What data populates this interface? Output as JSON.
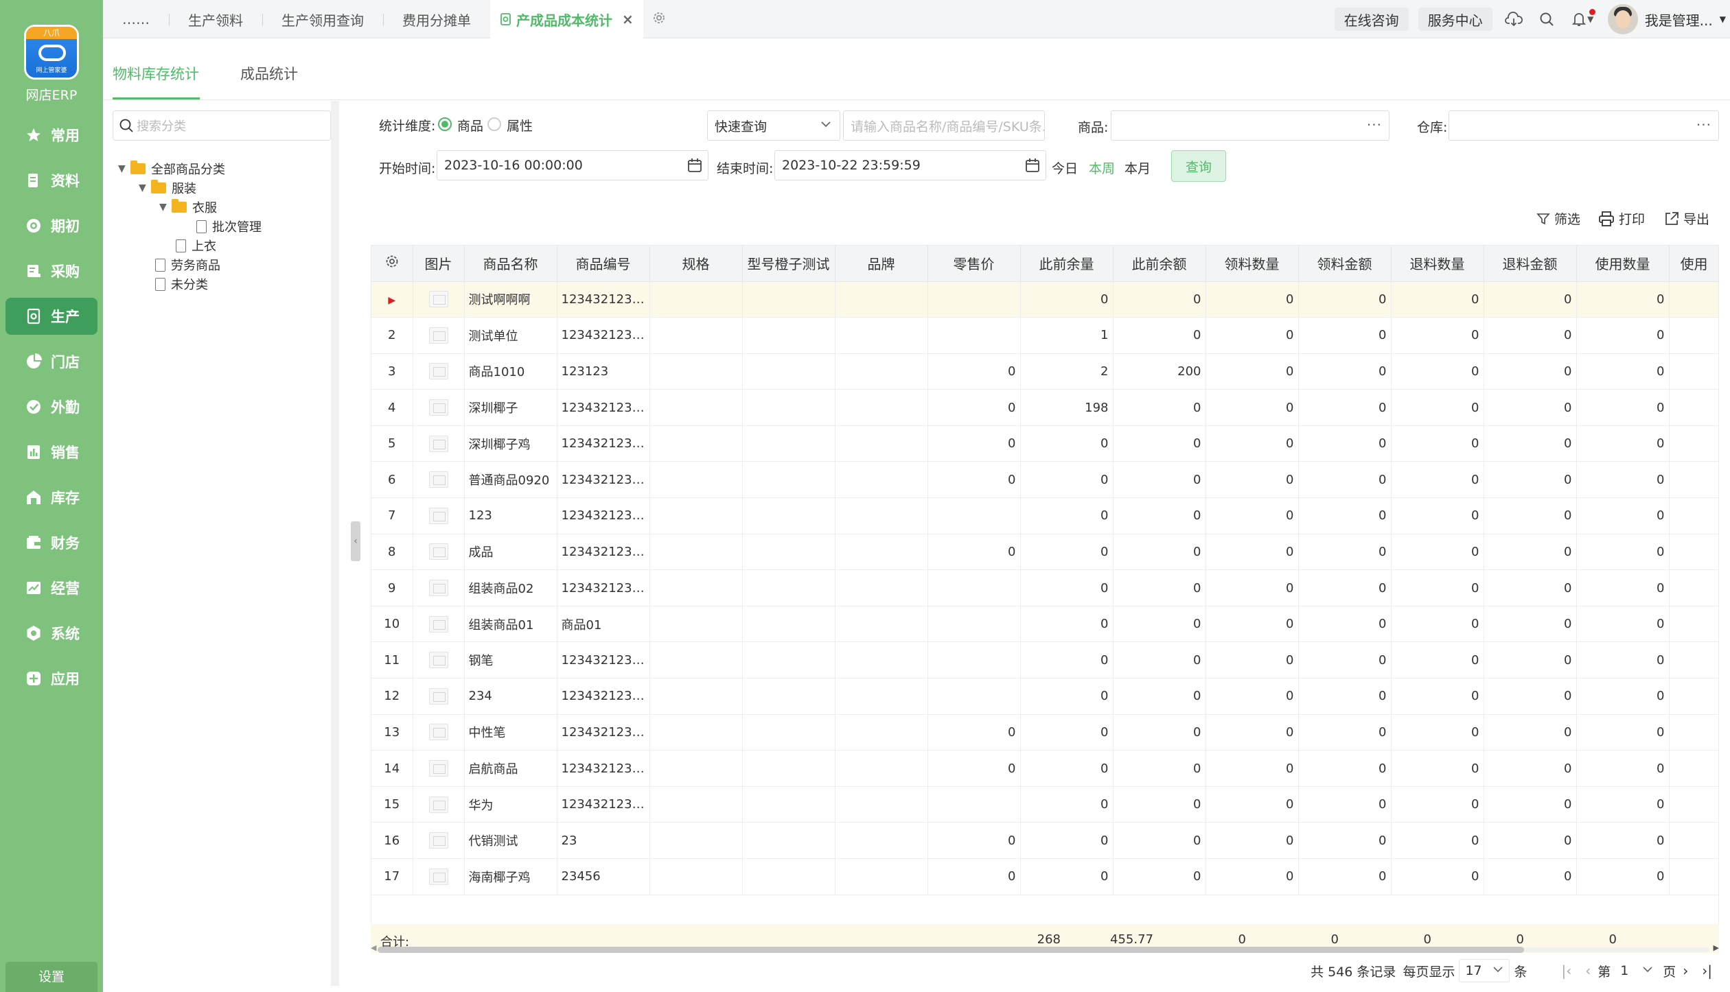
{
  "app": {
    "logo_badge": "八爪",
    "logo_text": "网上管家婆",
    "name": "网店ERP",
    "settings_label": "设置"
  },
  "nav": [
    {
      "label": "常用",
      "icon": "star-icon",
      "active": false
    },
    {
      "label": "资料",
      "icon": "document-icon",
      "active": false
    },
    {
      "label": "期初",
      "icon": "target-icon",
      "active": false
    },
    {
      "label": "采购",
      "icon": "purchase-icon",
      "active": false
    },
    {
      "label": "生产",
      "icon": "production-icon",
      "active": true
    },
    {
      "label": "门店",
      "icon": "pie-icon",
      "active": false
    },
    {
      "label": "外勤",
      "icon": "field-icon",
      "active": false
    },
    {
      "label": "销售",
      "icon": "bar-chart-icon",
      "active": false
    },
    {
      "label": "库存",
      "icon": "warehouse-icon",
      "active": false
    },
    {
      "label": "财务",
      "icon": "wallet-icon",
      "active": false
    },
    {
      "label": "经营",
      "icon": "trend-icon",
      "active": false
    },
    {
      "label": "系统",
      "icon": "gear-icon",
      "active": false
    },
    {
      "label": "应用",
      "icon": "plus-square-icon",
      "active": false
    }
  ],
  "tabs": {
    "ellipsis": "……",
    "items": [
      "生产领料",
      "生产领用查询",
      "费用分摊单"
    ],
    "active": "产成品成本统计",
    "close": "×"
  },
  "topright": {
    "consult": "在线咨询",
    "service": "服务中心",
    "user": "我是管理..."
  },
  "subtabs": [
    "物料库存统计",
    "成品统计"
  ],
  "tree": {
    "search_placeholder": "搜索分类",
    "nodes": [
      {
        "label": "全部商品分类",
        "type": "folder",
        "expanded": true
      },
      {
        "label": "服装",
        "type": "folder",
        "expanded": true
      },
      {
        "label": "衣服",
        "type": "folder",
        "expanded": true
      },
      {
        "label": "批次管理",
        "type": "file"
      },
      {
        "label": "上衣",
        "type": "file"
      },
      {
        "label": "劳务商品",
        "type": "file"
      },
      {
        "label": "未分类",
        "type": "file"
      }
    ]
  },
  "filters": {
    "dimension_label": "统计维度:",
    "dim_product": "商品",
    "dim_attr": "属性",
    "quick_query": "快速查询",
    "quick_placeholder": "请输入商品名称/商品编号/SKU条...",
    "product_label": "商品:",
    "warehouse_label": "仓库:",
    "start_label": "开始时间:",
    "start_value": "2023-10-16 00:00:00",
    "end_label": "结束时间:",
    "end_value": "2023-10-22 23:59:59",
    "today": "今日",
    "this_week": "本周",
    "this_month": "本月",
    "query": "查询"
  },
  "toolbar": {
    "filter": "筛选",
    "print": "打印",
    "export": "导出"
  },
  "table": {
    "columns": [
      "图片",
      "商品名称",
      "商品编号",
      "规格",
      "型号橙子测试",
      "品牌",
      "零售价",
      "此前余量",
      "此前余额",
      "领料数量",
      "领料金额",
      "退料数量",
      "退料金额",
      "使用数量",
      "使用"
    ],
    "rows": [
      {
        "no": "",
        "name": "测试啊啊啊",
        "code": "1234321231...",
        "retail": "",
        "prev_qty": "0",
        "prev_amt": "0",
        "pick_qty": "0",
        "pick_amt": "0",
        "ret_qty": "0",
        "ret_amt": "0",
        "use_qty": "0"
      },
      {
        "no": "2",
        "name": "测试单位",
        "code": "1234321231...",
        "retail": "",
        "prev_qty": "1",
        "prev_amt": "0",
        "pick_qty": "0",
        "pick_amt": "0",
        "ret_qty": "0",
        "ret_amt": "0",
        "use_qty": "0"
      },
      {
        "no": "3",
        "name": "商品1010",
        "code": "123123",
        "retail": "0",
        "prev_qty": "2",
        "prev_amt": "200",
        "pick_qty": "0",
        "pick_amt": "0",
        "ret_qty": "0",
        "ret_amt": "0",
        "use_qty": "0"
      },
      {
        "no": "4",
        "name": "深圳椰子",
        "code": "1234321231...",
        "retail": "0",
        "prev_qty": "198",
        "prev_amt": "0",
        "pick_qty": "0",
        "pick_amt": "0",
        "ret_qty": "0",
        "ret_amt": "0",
        "use_qty": "0"
      },
      {
        "no": "5",
        "name": "深圳椰子鸡",
        "code": "1234321231...",
        "retail": "0",
        "prev_qty": "0",
        "prev_amt": "0",
        "pick_qty": "0",
        "pick_amt": "0",
        "ret_qty": "0",
        "ret_amt": "0",
        "use_qty": "0"
      },
      {
        "no": "6",
        "name": "普通商品0920",
        "code": "1234321231...",
        "retail": "0",
        "prev_qty": "0",
        "prev_amt": "0",
        "pick_qty": "0",
        "pick_amt": "0",
        "ret_qty": "0",
        "ret_amt": "0",
        "use_qty": "0"
      },
      {
        "no": "7",
        "name": "123",
        "code": "1234321231...",
        "retail": "",
        "prev_qty": "0",
        "prev_amt": "0",
        "pick_qty": "0",
        "pick_amt": "0",
        "ret_qty": "0",
        "ret_amt": "0",
        "use_qty": "0"
      },
      {
        "no": "8",
        "name": "成品",
        "code": "1234321231...",
        "retail": "0",
        "prev_qty": "0",
        "prev_amt": "0",
        "pick_qty": "0",
        "pick_amt": "0",
        "ret_qty": "0",
        "ret_amt": "0",
        "use_qty": "0"
      },
      {
        "no": "9",
        "name": "组装商品02",
        "code": "1234321231...",
        "retail": "",
        "prev_qty": "0",
        "prev_amt": "0",
        "pick_qty": "0",
        "pick_amt": "0",
        "ret_qty": "0",
        "ret_amt": "0",
        "use_qty": "0"
      },
      {
        "no": "10",
        "name": "组装商品01",
        "code": "商品01",
        "retail": "",
        "prev_qty": "0",
        "prev_amt": "0",
        "pick_qty": "0",
        "pick_amt": "0",
        "ret_qty": "0",
        "ret_amt": "0",
        "use_qty": "0"
      },
      {
        "no": "11",
        "name": "钢笔",
        "code": "1234321231...",
        "retail": "",
        "prev_qty": "0",
        "prev_amt": "0",
        "pick_qty": "0",
        "pick_amt": "0",
        "ret_qty": "0",
        "ret_amt": "0",
        "use_qty": "0"
      },
      {
        "no": "12",
        "name": "234",
        "code": "1234321231...",
        "retail": "",
        "prev_qty": "0",
        "prev_amt": "0",
        "pick_qty": "0",
        "pick_amt": "0",
        "ret_qty": "0",
        "ret_amt": "0",
        "use_qty": "0"
      },
      {
        "no": "13",
        "name": "中性笔",
        "code": "1234321231...",
        "retail": "0",
        "prev_qty": "0",
        "prev_amt": "0",
        "pick_qty": "0",
        "pick_amt": "0",
        "ret_qty": "0",
        "ret_amt": "0",
        "use_qty": "0"
      },
      {
        "no": "14",
        "name": "启航商品",
        "code": "1234321231...",
        "retail": "0",
        "prev_qty": "0",
        "prev_amt": "0",
        "pick_qty": "0",
        "pick_amt": "0",
        "ret_qty": "0",
        "ret_amt": "0",
        "use_qty": "0"
      },
      {
        "no": "15",
        "name": "华为",
        "code": "1234321231...",
        "retail": "",
        "prev_qty": "0",
        "prev_amt": "0",
        "pick_qty": "0",
        "pick_amt": "0",
        "ret_qty": "0",
        "ret_amt": "0",
        "use_qty": "0"
      },
      {
        "no": "16",
        "name": "代销测试",
        "code": "23",
        "retail": "0",
        "prev_qty": "0",
        "prev_amt": "0",
        "pick_qty": "0",
        "pick_amt": "0",
        "ret_qty": "0",
        "ret_amt": "0",
        "use_qty": "0"
      },
      {
        "no": "17",
        "name": "海南椰子鸡",
        "code": "23456",
        "retail": "0",
        "prev_qty": "0",
        "prev_amt": "0",
        "pick_qty": "0",
        "pick_amt": "0",
        "ret_qty": "0",
        "ret_amt": "0",
        "use_qty": "0"
      }
    ],
    "total": {
      "label": "合计:",
      "prev_qty": "268",
      "prev_amt": "455.77",
      "pick_qty": "0",
      "pick_amt": "0",
      "ret_qty": "0",
      "ret_amt": "0",
      "use_qty": "0"
    }
  },
  "pager": {
    "summary": "共 546 条记录",
    "per_page_label": "每页显示",
    "per_page": "17",
    "unit": "条",
    "page_prefix": "第",
    "page": "1",
    "page_suffix": "页"
  },
  "colors": {
    "accent": "#52b96a",
    "sidebar": "#7ec27e",
    "sidebar_active": "#3f9e5b",
    "selected_row": "#fdf9e8"
  }
}
